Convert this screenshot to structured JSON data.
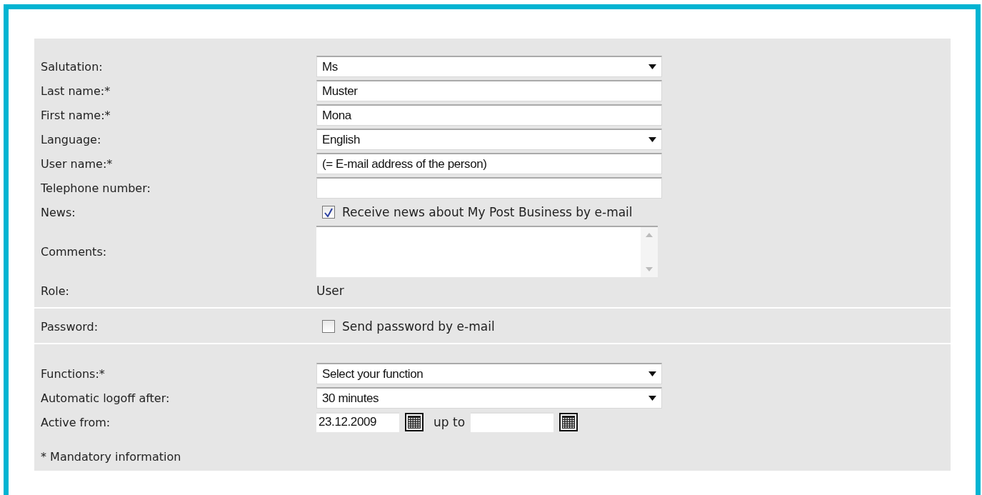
{
  "sections": [
    {
      "rows": [
        {
          "label": "Salutation:",
          "kind": "select",
          "value": "Ms"
        },
        {
          "label": "Last name:*",
          "kind": "text",
          "value": "Muster"
        },
        {
          "label": "First name:*",
          "kind": "text",
          "value": "Mona"
        },
        {
          "label": "Language:",
          "kind": "select",
          "value": "English"
        },
        {
          "label": "User name:*",
          "kind": "text",
          "value": "(= E-mail address of the person)"
        },
        {
          "label": "Telephone number:",
          "kind": "text"
        },
        {
          "label": "News:",
          "kind": "checkbox",
          "checked": true,
          "text": "Receive news about My Post Business by e-mail"
        },
        {
          "label": "Comments:",
          "kind": "textarea"
        },
        {
          "label": "Role:",
          "kind": "static",
          "text": "User"
        }
      ]
    },
    {
      "rows": [
        {
          "label": "Password:",
          "kind": "checkbox",
          "checked": false,
          "text": "Send password by e-mail"
        }
      ]
    },
    {
      "rows": [
        {
          "label": "Functions:*",
          "kind": "select",
          "value": "Select your function"
        },
        {
          "label": "Automatic logoff after:",
          "kind": "select",
          "value": "30 minutes"
        },
        {
          "label": "Active from:",
          "kind": "daterange",
          "from": "23.12.2009",
          "separator": "up to"
        }
      ],
      "footnote": "* Mandatory information"
    }
  ]
}
